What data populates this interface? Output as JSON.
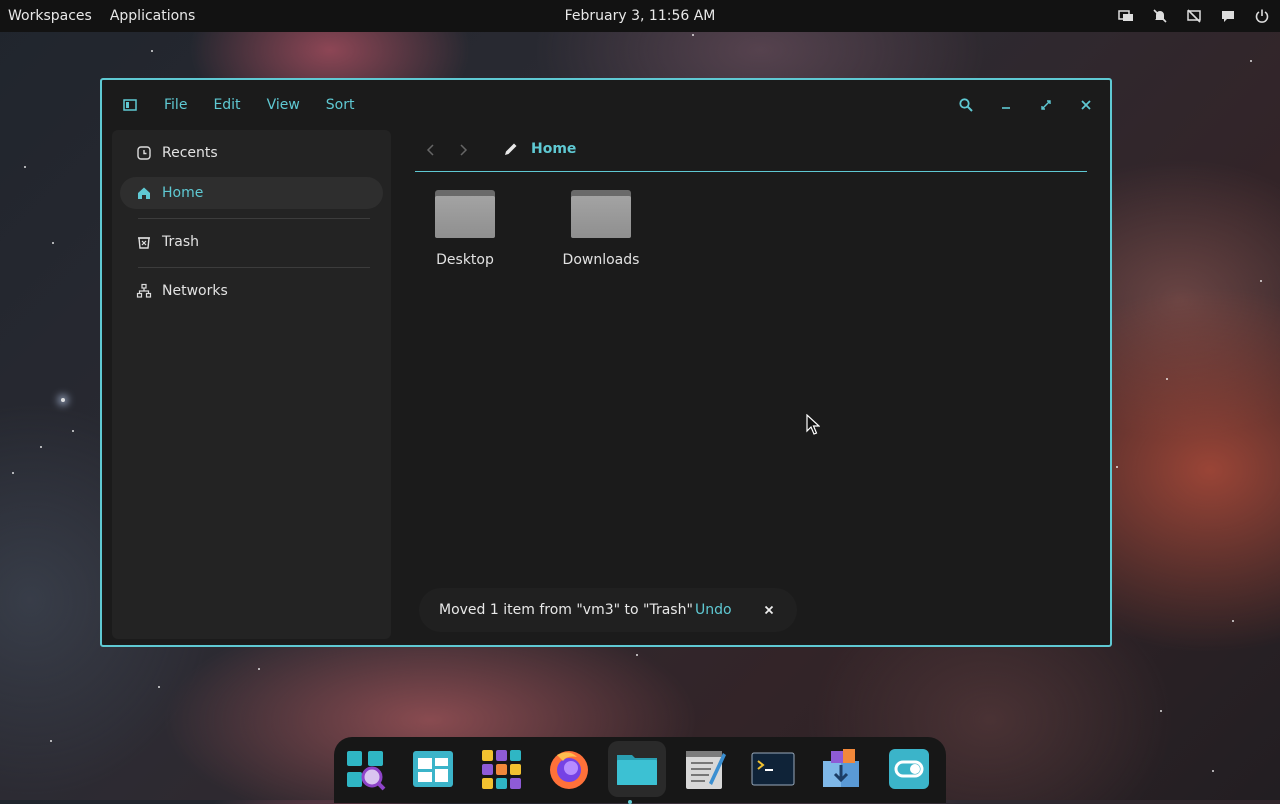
{
  "topbar": {
    "workspaces": "Workspaces",
    "applications": "Applications",
    "clock": "February 3, 11:56 AM",
    "tray_icons": [
      "display-icon",
      "notifications-off-icon",
      "network-off-icon",
      "chat-icon",
      "power-icon"
    ]
  },
  "window": {
    "menu": {
      "file": "File",
      "edit": "Edit",
      "view": "View",
      "sort": "Sort"
    },
    "sidebar": {
      "items": [
        {
          "label": "Recents",
          "icon": "clock-icon"
        },
        {
          "label": "Home",
          "icon": "home-icon",
          "active": true
        },
        {
          "label": "Trash",
          "icon": "trash-icon"
        },
        {
          "label": "Networks",
          "icon": "network-icon"
        }
      ]
    },
    "path": {
      "current": "Home"
    },
    "files": [
      {
        "name": "Desktop",
        "icon": "folder-icon"
      },
      {
        "name": "Downloads",
        "icon": "folder-icon"
      }
    ],
    "toast": {
      "message": "Moved 1 item from \"vm3\" to \"Trash\"",
      "action": "Undo"
    }
  },
  "dock": {
    "apps": [
      "search-app-icon",
      "multitasking-view-icon",
      "app-grid-icon",
      "firefox-icon",
      "files-icon",
      "text-editor-icon",
      "terminal-icon",
      "software-store-icon",
      "settings-toggle-icon"
    ],
    "running": "files-icon"
  },
  "colors": {
    "accent": "#5fc9d3",
    "window_bg": "#1b1b1b",
    "sidebar_bg": "#232323",
    "panel_bg": "#121212"
  }
}
